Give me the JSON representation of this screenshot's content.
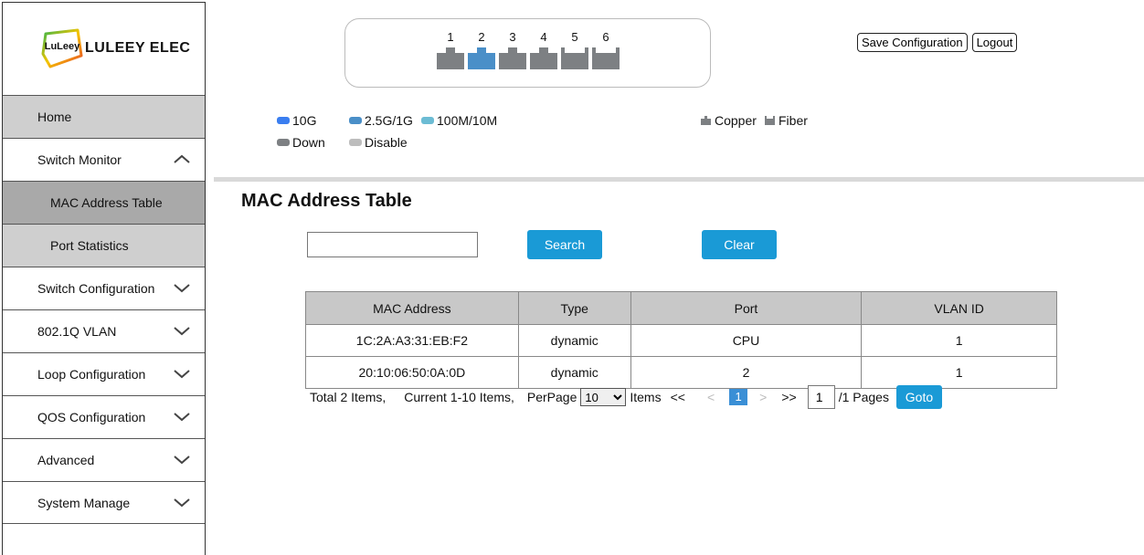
{
  "brand": {
    "badge": "LuLeey",
    "name": "LULEEY ELEC"
  },
  "sidebar": {
    "items": [
      {
        "label": "Home"
      },
      {
        "label": "Switch Monitor"
      },
      {
        "label": "MAC Address Table"
      },
      {
        "label": "Port Statistics"
      },
      {
        "label": "Switch Configuration"
      },
      {
        "label": "802.1Q VLAN"
      },
      {
        "label": "Loop Configuration"
      },
      {
        "label": "QOS Configuration"
      },
      {
        "label": "Advanced"
      },
      {
        "label": "System Manage"
      }
    ]
  },
  "ports": [
    {
      "num": "1",
      "color": "#7d8083"
    },
    {
      "num": "2",
      "color": "#4a8fc8"
    },
    {
      "num": "3",
      "color": "#7d8083"
    },
    {
      "num": "4",
      "color": "#7d8083"
    },
    {
      "num": "5",
      "color": "#7d8083"
    },
    {
      "num": "6",
      "color": "#7d8083"
    }
  ],
  "top_buttons": {
    "save": "Save Configuration",
    "logout": "Logout"
  },
  "legend": {
    "speed_10g": {
      "label": "10G",
      "color": "#3a7ef0"
    },
    "speed_2_5g": {
      "label": "2.5G/1G",
      "color": "#4a8fc8"
    },
    "speed_100m": {
      "label": "100M/10M",
      "color": "#6cbcd4"
    },
    "down": {
      "label": "Down",
      "color": "#7d8083"
    },
    "disable": {
      "label": "Disable",
      "color": "#bdbdbd"
    },
    "copper": {
      "label": "Copper",
      "icon": "copper-port-icon"
    },
    "fiber": {
      "label": "Fiber",
      "icon": "fiber-port-icon"
    }
  },
  "page_title": "MAC Address Table",
  "search": {
    "value": "",
    "button": "Search",
    "clear": "Clear"
  },
  "table": {
    "headers": [
      "MAC Address",
      "Type",
      "Port",
      "VLAN ID"
    ],
    "rows": [
      [
        "1C:2A:A3:31:EB:F2",
        "dynamic",
        "CPU",
        "1"
      ],
      [
        "20:10:06:50:0A:0D",
        "dynamic",
        "2",
        "1"
      ]
    ]
  },
  "pager": {
    "total": "Total 2 Items,",
    "current": "Current 1-10 Items,",
    "per_page_label": "PerPage",
    "per_page_value": "10",
    "items_label": "Items",
    "first": "<<",
    "prev": "<",
    "page": "1",
    "next": ">",
    "last": ">>",
    "goto_value": "1",
    "pages_label": "/1 Pages",
    "goto": "Goto"
  }
}
